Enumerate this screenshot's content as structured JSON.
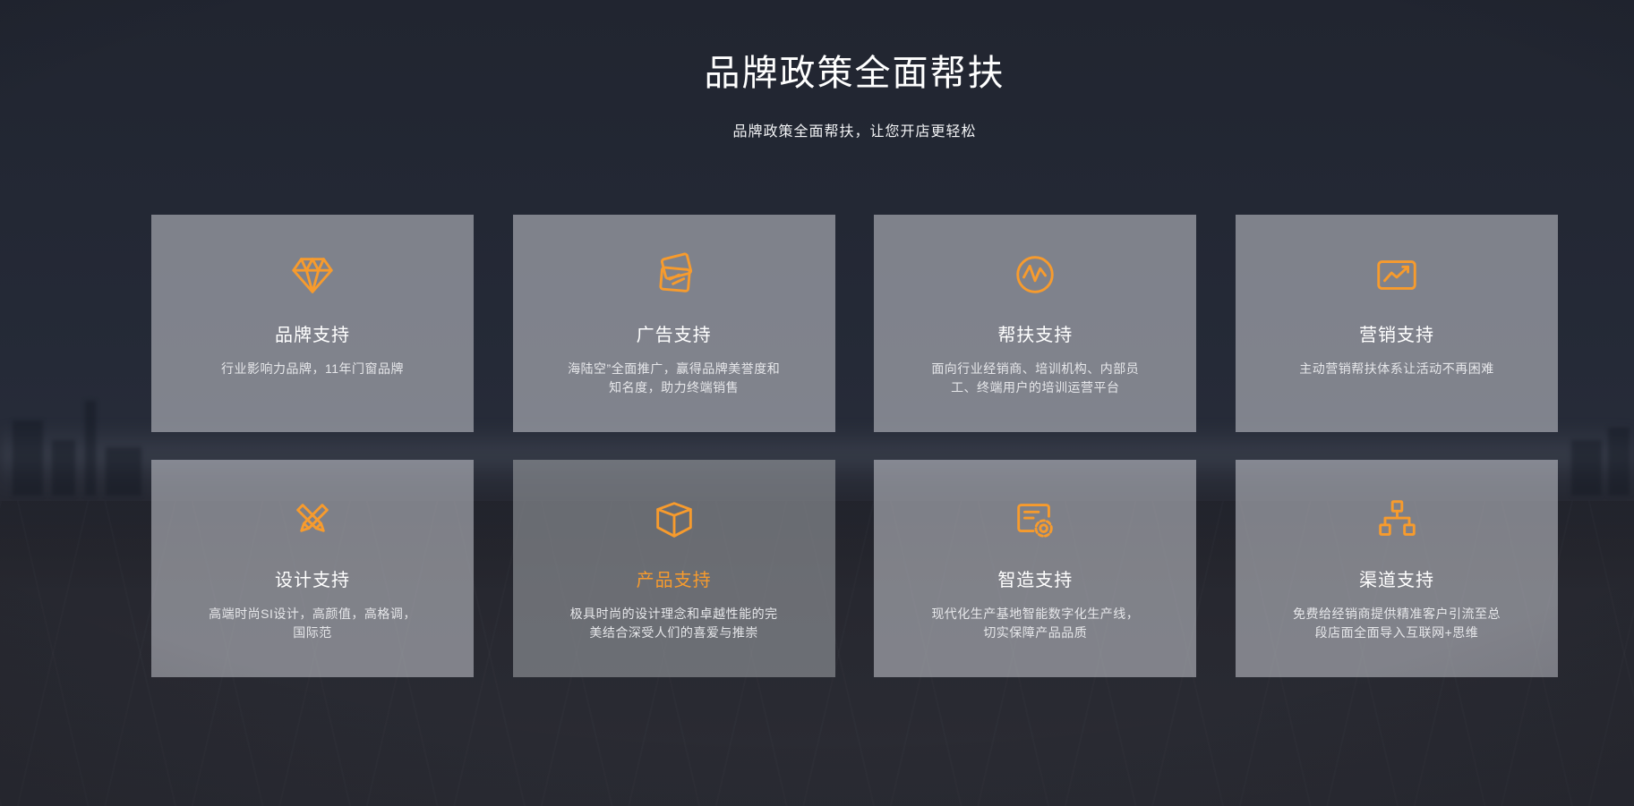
{
  "header": {
    "title": "品牌政策全面帮扶",
    "subtitle": "品牌政策全面帮扶，让您开店更轻松"
  },
  "colors": {
    "accent": "#f79b2d",
    "background": "#252a37",
    "card": "#81838a",
    "card_active": "#707175",
    "title_text": "#ffffff",
    "description_text": "#e6e7ea"
  },
  "cards": [
    {
      "id": "brand",
      "icon": "diamond-icon",
      "title": "品牌支持",
      "description": "行业影响力品牌，11年门窗品牌",
      "active": false
    },
    {
      "id": "advertising",
      "icon": "ad-pages-icon",
      "title": "广告支持",
      "description": "海陆空”全面推广，赢得品牌美誉度和知名度，助力终端销售",
      "active": false
    },
    {
      "id": "assistance",
      "icon": "pulse-circle-icon",
      "title": "帮扶支持",
      "description": "面向行业经销商、培训机构、内部员工、终端用户的培训运营平台",
      "active": false
    },
    {
      "id": "marketing",
      "icon": "trend-chart-icon",
      "title": "营销支持",
      "description": "主动营销帮扶体系让活动不再困难",
      "active": false
    },
    {
      "id": "design",
      "icon": "pencil-cross-icon",
      "title": "设计支持",
      "description": "高端时尚SI设计，高颜值，高格调，国际范",
      "active": false
    },
    {
      "id": "product",
      "icon": "cube-icon",
      "title": "产品支持",
      "description": "极具时尚的设计理念和卓越性能的完美结合深受人们的喜爱与推崇",
      "active": true
    },
    {
      "id": "manufacturing",
      "icon": "gear-doc-icon",
      "title": "智造支持",
      "description": "现代化生产基地智能数字化生产线，切实保障产品品质",
      "active": false
    },
    {
      "id": "channel",
      "icon": "org-chart-icon",
      "title": "渠道支持",
      "description": "免费给经销商提供精准客户引流至总段店面全面导入互联网+思维",
      "active": false
    }
  ]
}
